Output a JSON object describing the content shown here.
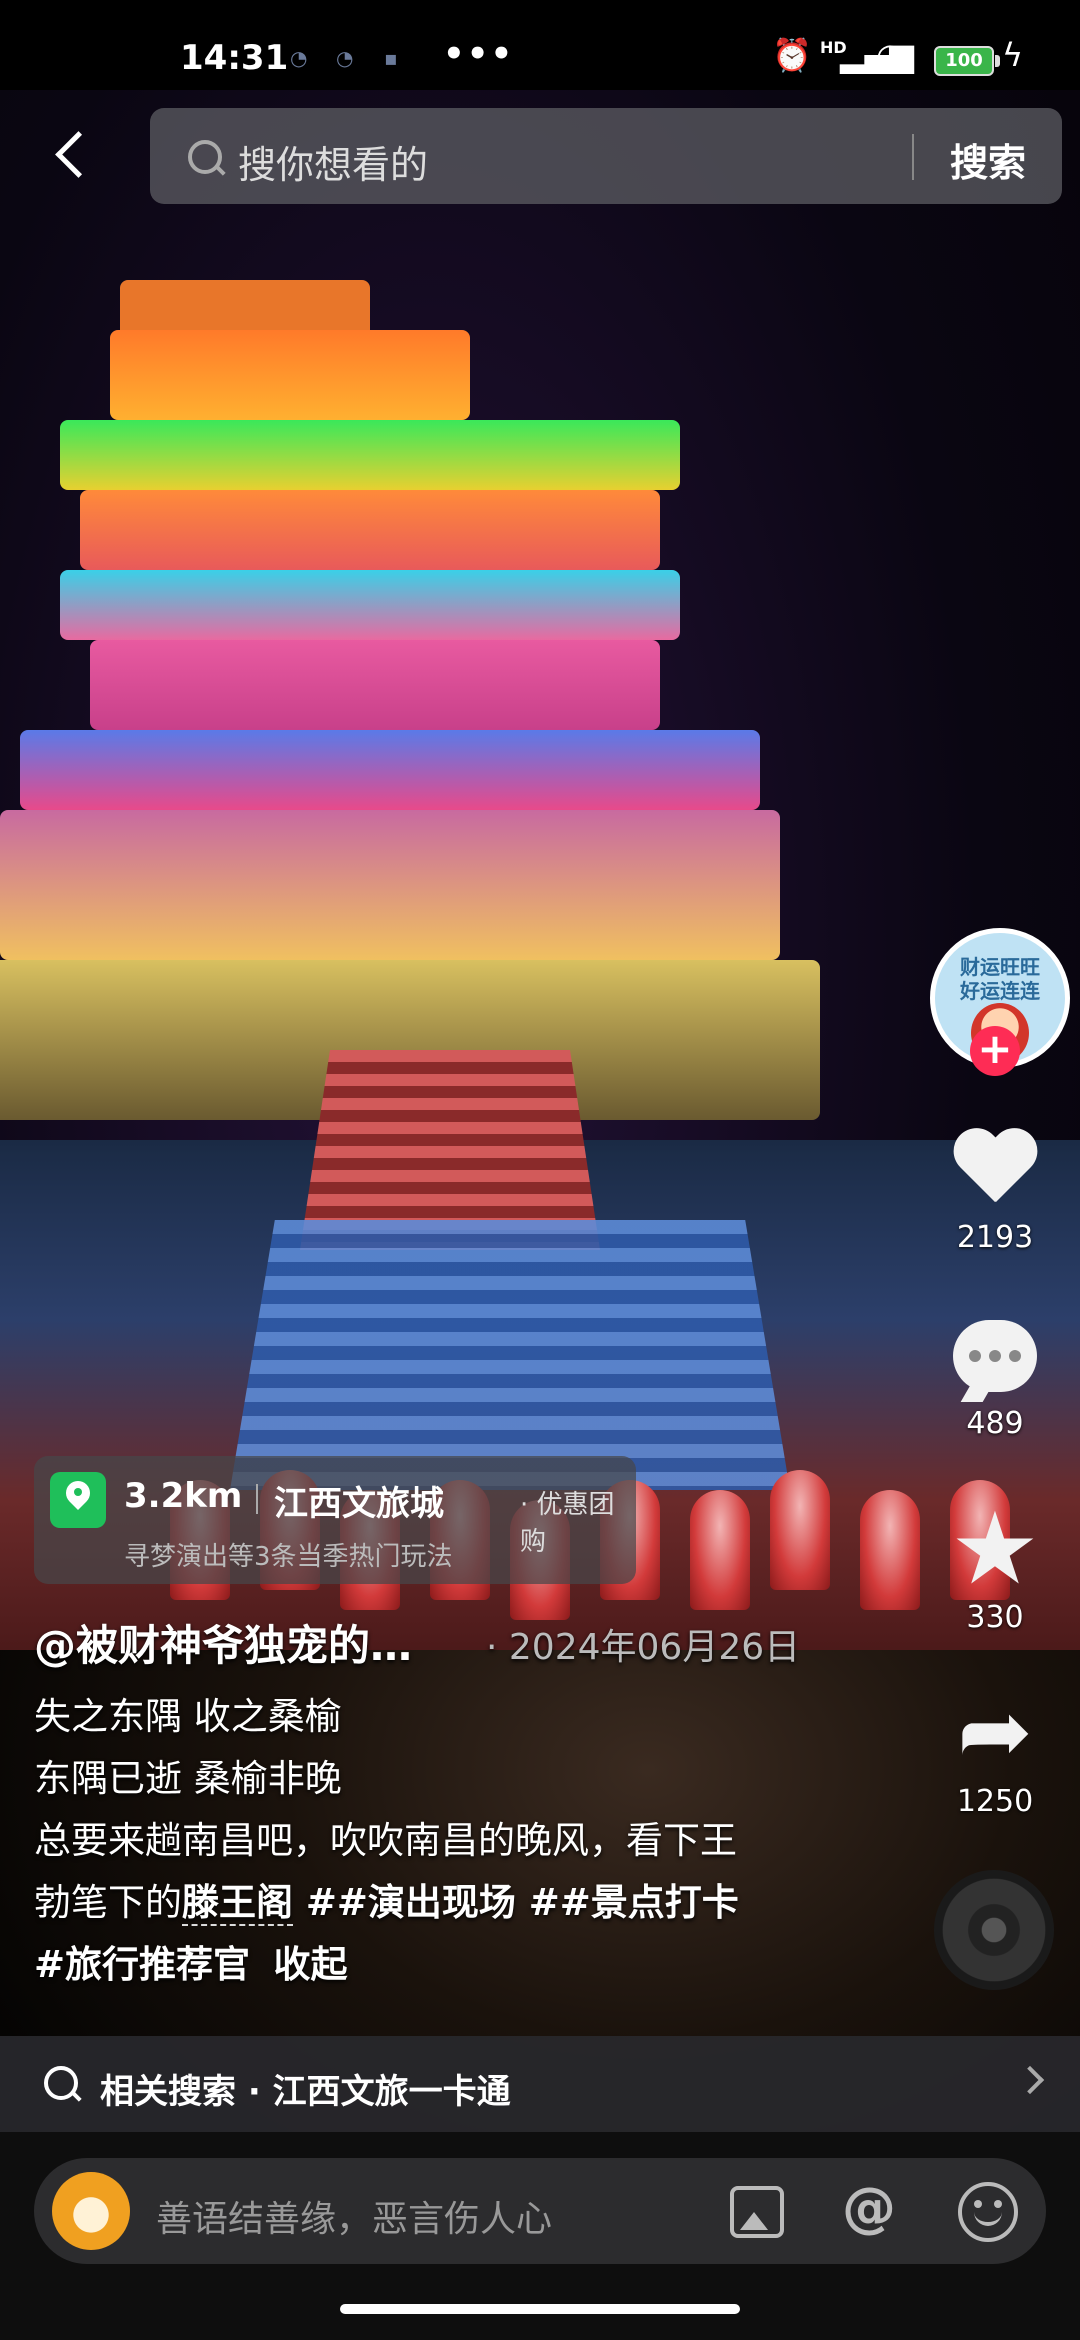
{
  "status_bar": {
    "time": "14:31",
    "dots": "•••",
    "network": "HD",
    "battery": "100"
  },
  "search": {
    "placeholder": "搜你想看的",
    "button": "搜索"
  },
  "actions": {
    "avatar_text_1": "财运旺旺",
    "avatar_text_2": "好运连连",
    "follow": "+",
    "likes": "2193",
    "comments": "489",
    "favorites": "330",
    "shares": "1250"
  },
  "poi": {
    "distance": "3.2km",
    "name": "江西文旅城",
    "tag": "· 优惠团购",
    "subtitle": "寻梦演出等3条当季热门玩法"
  },
  "post": {
    "author": "@被财神爷独宠的…",
    "date": "· 2024年06月26日",
    "line1": "失之东隅 收之桑榆",
    "line2": "东隅已逝 桑榆非晚",
    "line3": "总要来趟南昌吧，吹吹南昌的晚风，看下王",
    "line4_prefix": "勃笔下的",
    "keyword": "滕王阁",
    "tag1": " ##演出现场",
    "tag2": " ##景点打卡",
    "tag3": "#旅行推荐官",
    "collapse": "收起"
  },
  "related": {
    "text": "相关搜索 · 江西文旅一卡通"
  },
  "comment_bar": {
    "placeholder": "善语结善缘，恶言伤人心",
    "at": "@"
  },
  "colors": {
    "accent": "#fe2c55",
    "poi_pin": "#1fbf5a"
  }
}
